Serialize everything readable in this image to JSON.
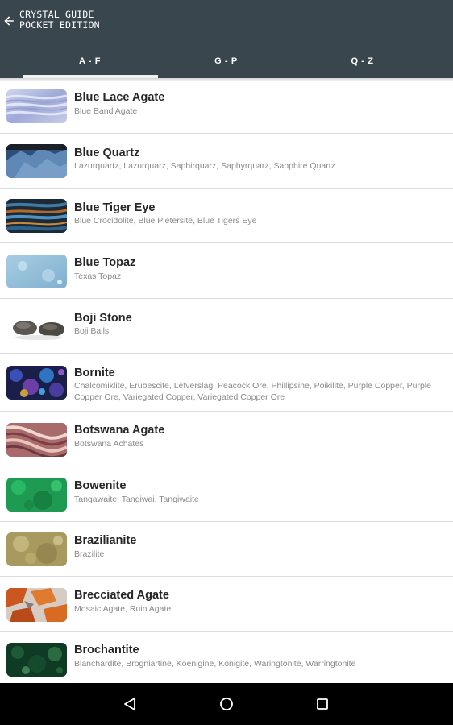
{
  "app": {
    "title_line1": "CRYSTAL GUIDE",
    "title_line2": "POCKET EDITION",
    "back_icon": "arrow-left-icon"
  },
  "tabs": [
    {
      "label": "A - F",
      "selected": true
    },
    {
      "label": "G - P",
      "selected": false
    },
    {
      "label": "Q - Z",
      "selected": false
    }
  ],
  "colors": {
    "appbar": "#3a464d",
    "indicator": "#eef1f2",
    "name_text": "#262626",
    "alias_text": "#8a8a8a",
    "navbar": "#000000"
  },
  "crystals": [
    {
      "name": "Blue Lace Agate",
      "aliases": "Blue Band Agate"
    },
    {
      "name": "Blue Quartz",
      "aliases": "Lazurquartz, Lazurquarz, Saphirquarz, Saphyrquarz, Sapphire Quartz"
    },
    {
      "name": "Blue Tiger Eye",
      "aliases": "Blue Crocidolite, Blue Pietersite, Blue Tigers Eye"
    },
    {
      "name": "Blue Topaz",
      "aliases": "Texas Topaz"
    },
    {
      "name": "Boji Stone",
      "aliases": "Boji Balls"
    },
    {
      "name": "Bornite",
      "aliases": "Chalcomiklite, Erubescite, Lefverslag, Peacock Ore, Phillipsine, Poikilite, Purple Copper, Purple Copper Ore, Variegated Copper, Variegated Copper Ore"
    },
    {
      "name": "Botswana Agate",
      "aliases": "Botswana Achates"
    },
    {
      "name": "Bowenite",
      "aliases": "Tangawaite, Tangiwai, Tangiwaite"
    },
    {
      "name": "Brazilianite",
      "aliases": "Brazilite"
    },
    {
      "name": "Brecciated Agate",
      "aliases": "Mosaic Agate, Ruin Agate"
    },
    {
      "name": "Brochantite",
      "aliases": "Blanchardite, Brogniartine, Koenigine, Konigite, Waringtonite, Warringtonite"
    }
  ],
  "navbar": {
    "back_icon": "triangle-back-icon",
    "home_icon": "circle-home-icon",
    "recents_icon": "square-recents-icon"
  }
}
